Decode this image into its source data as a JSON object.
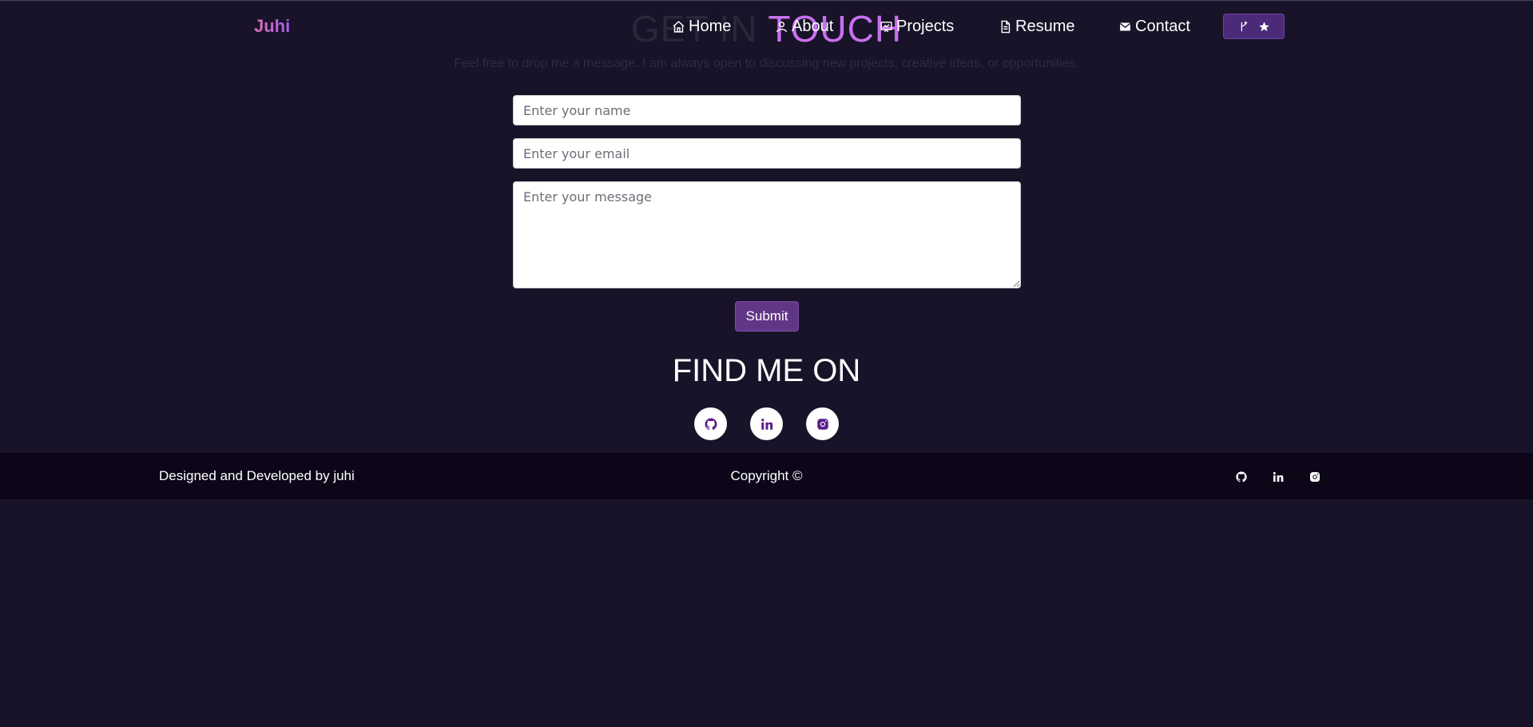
{
  "brand": "Juhi",
  "hero": {
    "title_part1": "GET IN",
    "title_part2": "TOUCH",
    "subtitle": "Feel free to drop me a message. I am always open to discussing new projects, creative ideas, or opportunities."
  },
  "nav": {
    "items": [
      {
        "label": "Home",
        "icon": "home-icon"
      },
      {
        "label": "About",
        "icon": "user-icon"
      },
      {
        "label": "Projects",
        "icon": "projects-icon"
      },
      {
        "label": "Resume",
        "icon": "document-icon"
      },
      {
        "label": "Contact",
        "icon": "mail-icon"
      }
    ],
    "github_button_icons": [
      "fork-icon",
      "star-icon"
    ]
  },
  "form": {
    "name_placeholder": "Enter your name",
    "email_placeholder": "Enter your email",
    "message_placeholder": "Enter your message",
    "submit_label": "Submit"
  },
  "social": {
    "title": "FIND ME ON",
    "icons": [
      "github-icon",
      "linkedin-icon",
      "instagram-icon"
    ]
  },
  "footer": {
    "left_text": "Designed and Developed by juhi",
    "center_text": "Copyright ©"
  },
  "colors": {
    "background": "#181328",
    "accent": "#c770f0",
    "button": "#623686",
    "footer": "#0c0618"
  }
}
